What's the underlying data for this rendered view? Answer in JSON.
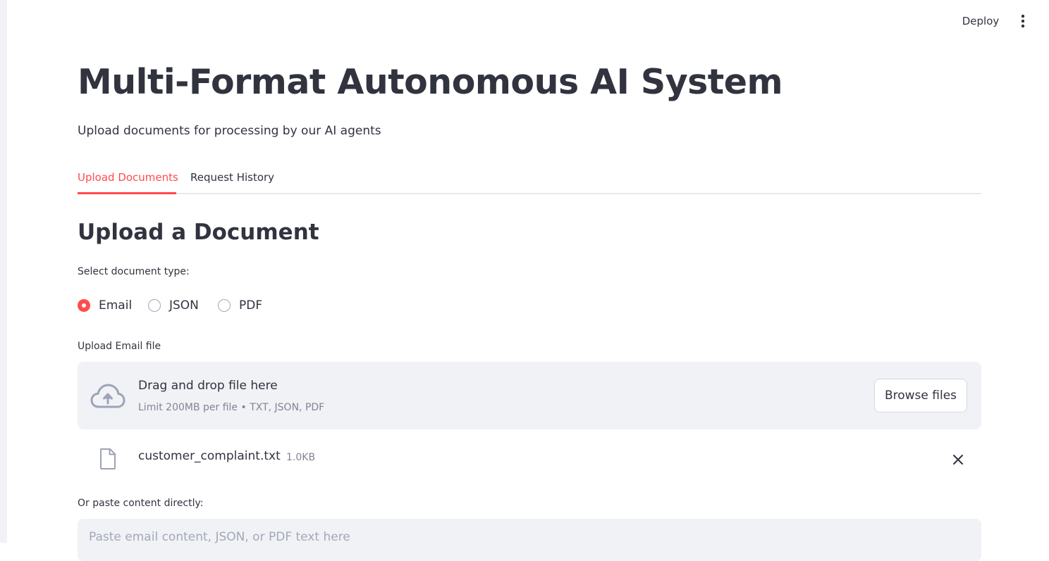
{
  "toolbar": {
    "deploy_label": "Deploy",
    "menu_icon": "more-vertical-icon"
  },
  "header": {
    "title": "Multi-Format Autonomous AI System",
    "subtitle": "Upload documents for processing by our AI agents"
  },
  "tabs": [
    {
      "label": "Upload Documents",
      "active": true
    },
    {
      "label": "Request History",
      "active": false
    }
  ],
  "upload_section": {
    "title": "Upload a Document",
    "doc_type_label": "Select document type:",
    "doc_type_options": [
      "Email",
      "JSON",
      "PDF"
    ],
    "doc_type_selected": "Email",
    "uploader_label": "Upload Email file",
    "dropzone": {
      "main_text": "Drag and drop file here",
      "limit_text": "Limit 200MB per file • TXT, JSON, PDF",
      "browse_label": "Browse files",
      "icon": "cloud-upload-icon"
    },
    "uploaded_file": {
      "name": "customer_complaint.txt",
      "size": "1.0KB",
      "icon": "file-icon",
      "remove_icon": "close-icon"
    },
    "paste_label": "Or paste content directly:",
    "paste_placeholder": "Paste email content, JSON, or PDF text here"
  },
  "colors": {
    "accent": "#ff4b4b",
    "text": "#31333f",
    "muted": "#808495",
    "surface": "#f0f2f6"
  }
}
